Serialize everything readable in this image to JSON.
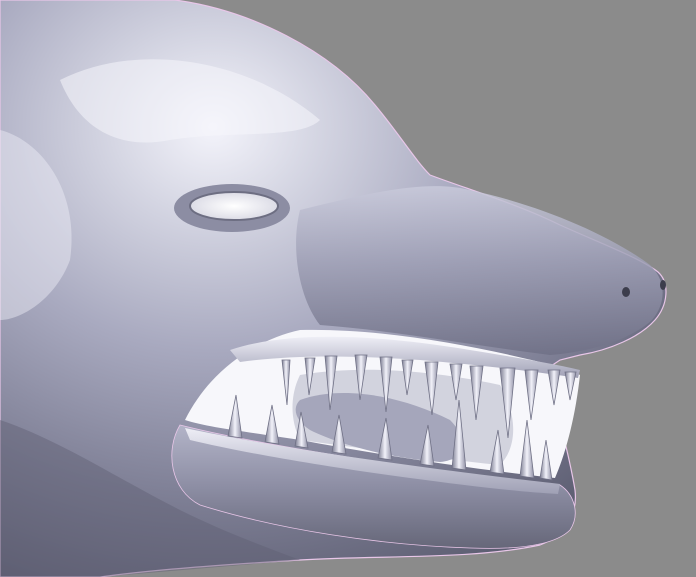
{
  "viewport": {
    "background": "#8b8b8b",
    "model_color": "#a7a8bb",
    "outline_color": "#e8c6e8"
  },
  "model": {
    "subject": "creature-head-sculpt",
    "features": [
      "eye",
      "nostril",
      "teeth",
      "gums",
      "jaw"
    ]
  }
}
